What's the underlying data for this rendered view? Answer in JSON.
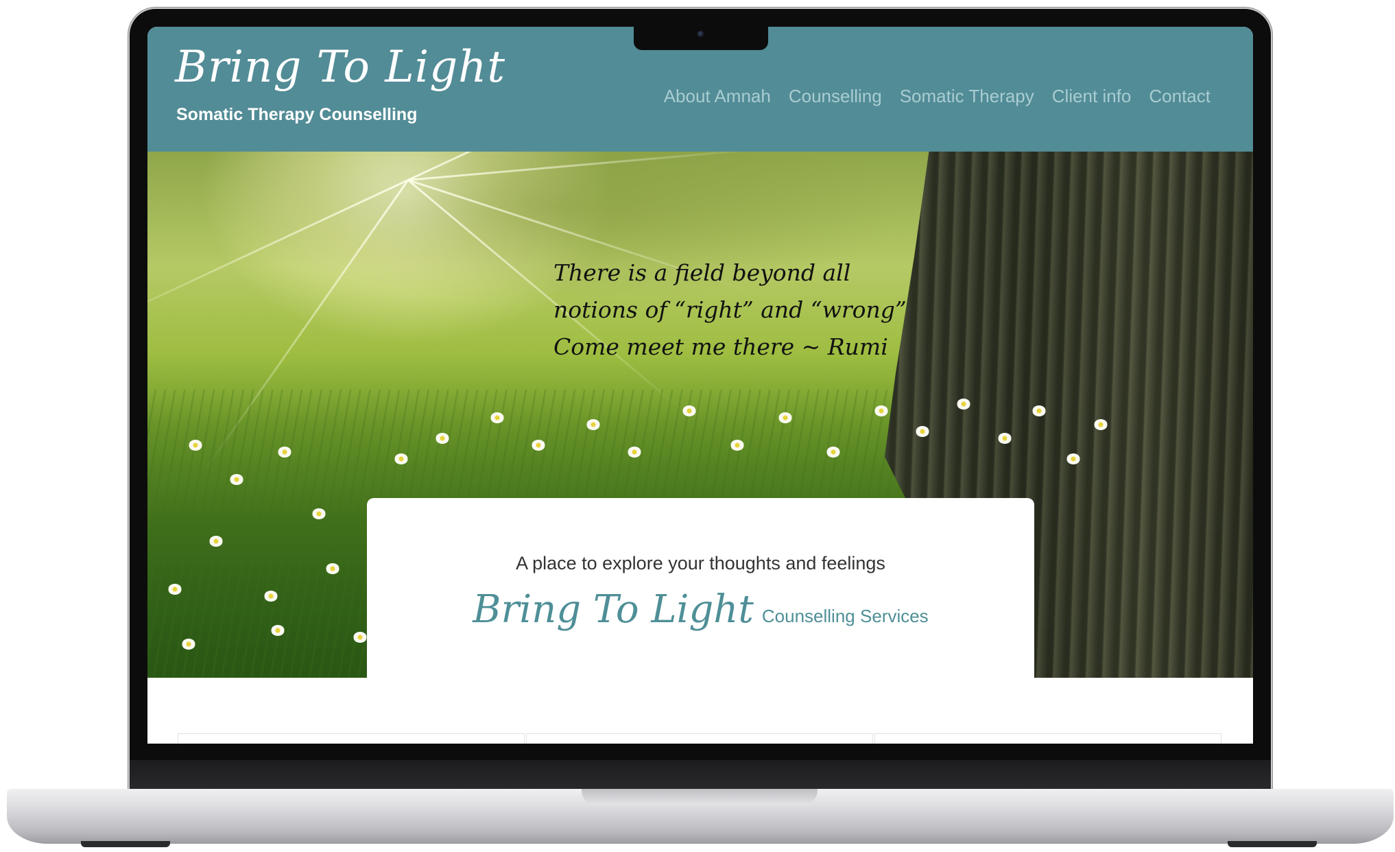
{
  "site": {
    "logo_text": "Bring To Light",
    "tagline": "Somatic Therapy Counselling"
  },
  "nav": {
    "items": [
      {
        "label": "About Amnah"
      },
      {
        "label": "Counselling"
      },
      {
        "label": "Somatic Therapy"
      },
      {
        "label": "Client info"
      },
      {
        "label": "Contact"
      }
    ]
  },
  "hero": {
    "quote_lines": [
      "There is a field beyond all",
      "notions of “right” and “wrong”",
      "Come meet me there ~ Rumi"
    ]
  },
  "intro": {
    "lead": "A place to explore your thoughts and feelings",
    "brand_script": "Bring To Light",
    "brand_sub": "Counselling Services"
  },
  "colors": {
    "header_bg": "#528c96",
    "nav_text": "#a9cdd2",
    "brand_accent": "#4f8f97"
  }
}
